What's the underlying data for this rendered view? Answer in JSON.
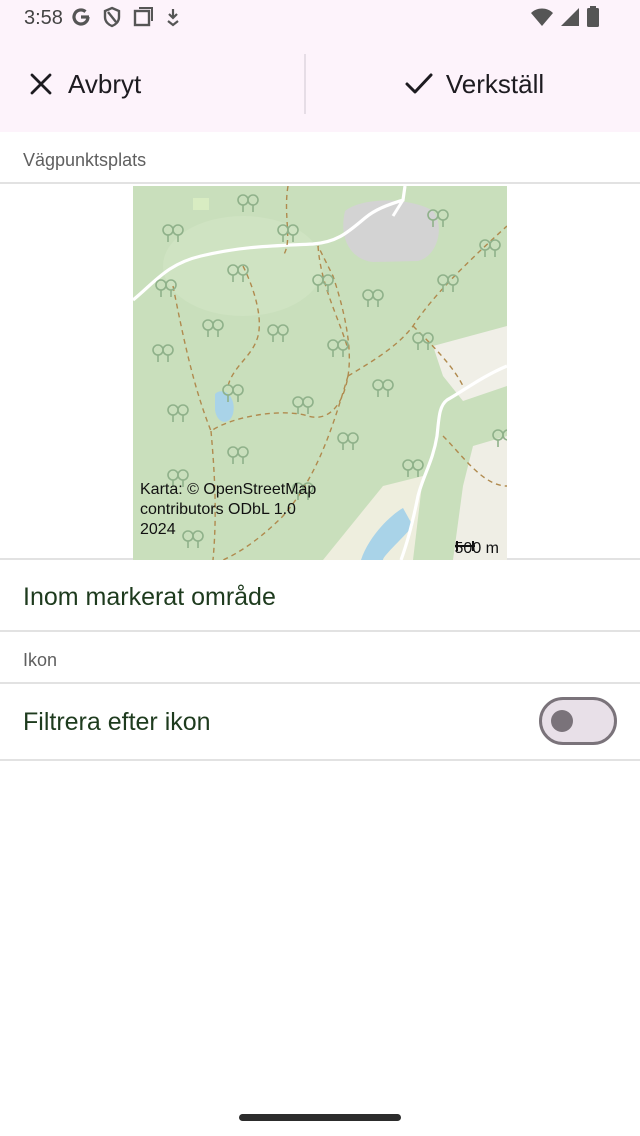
{
  "status_bar": {
    "time": "3:58",
    "left_icons": [
      "google-icon",
      "shield-icon",
      "square-icon",
      "download-icon"
    ],
    "right_icons": [
      "wifi-icon",
      "cell-signal-icon",
      "battery-icon"
    ]
  },
  "action_bar": {
    "cancel_label": "Avbryt",
    "apply_label": "Verkställ"
  },
  "sections": {
    "location_header": "Vägpunktsplats",
    "icon_header": "Ikon"
  },
  "map": {
    "attribution": "Karta: © OpenStreetMap contributors ODbL 1.0 2024",
    "scale_label": "500 m"
  },
  "rows": {
    "area_filter": "Inom markerat område",
    "icon_filter": "Filtrera efter ikon"
  },
  "toggle": {
    "checked": false
  },
  "colors": {
    "accent_bg": "#fdf3fb",
    "text_green": "#1e3b1e",
    "map_forest": "#c9dfbc",
    "map_water": "#a9d3e8"
  }
}
